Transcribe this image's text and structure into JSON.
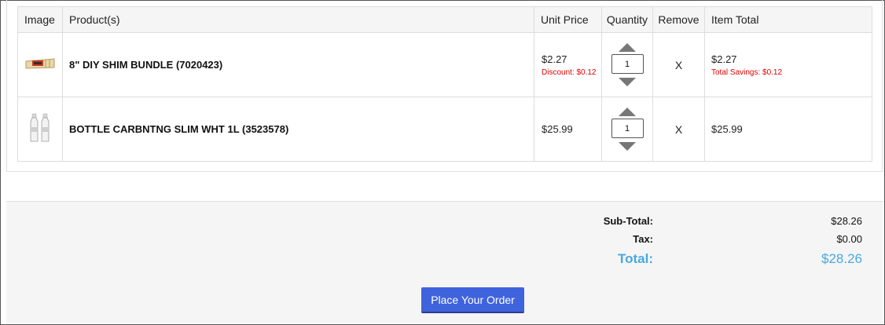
{
  "table": {
    "headers": {
      "image": "Image",
      "products": "Product(s)",
      "unit_price": "Unit Price",
      "quantity": "Quantity",
      "remove": "Remove",
      "item_total": "Item Total"
    },
    "rows": [
      {
        "thumbnail": "shim-bundle-thumbnail",
        "name": "8\" DIY SHIM BUNDLE (7020423)",
        "unit_price": "$2.27",
        "discount": "Discount: $0.12",
        "quantity": "1",
        "remove": "X",
        "item_total": "$2.27",
        "savings": "Total Savings: $0.12"
      },
      {
        "thumbnail": "bottle-thumbnail",
        "name": "BOTTLE CARBNTNG SLIM WHT 1L (3523578)",
        "unit_price": "$25.99",
        "quantity": "1",
        "remove": "X",
        "item_total": "$25.99"
      }
    ]
  },
  "summary": {
    "subtotal_label": "Sub-Total:",
    "subtotal_value": "$28.26",
    "tax_label": "Tax:",
    "tax_value": "$0.00",
    "total_label": "Total:",
    "total_value": "$28.26"
  },
  "order_button": "Place Your Order",
  "colors": {
    "accent_total": "#4aa8e0",
    "button_bg": "#3e63dd",
    "discount_red": "#e00000"
  }
}
